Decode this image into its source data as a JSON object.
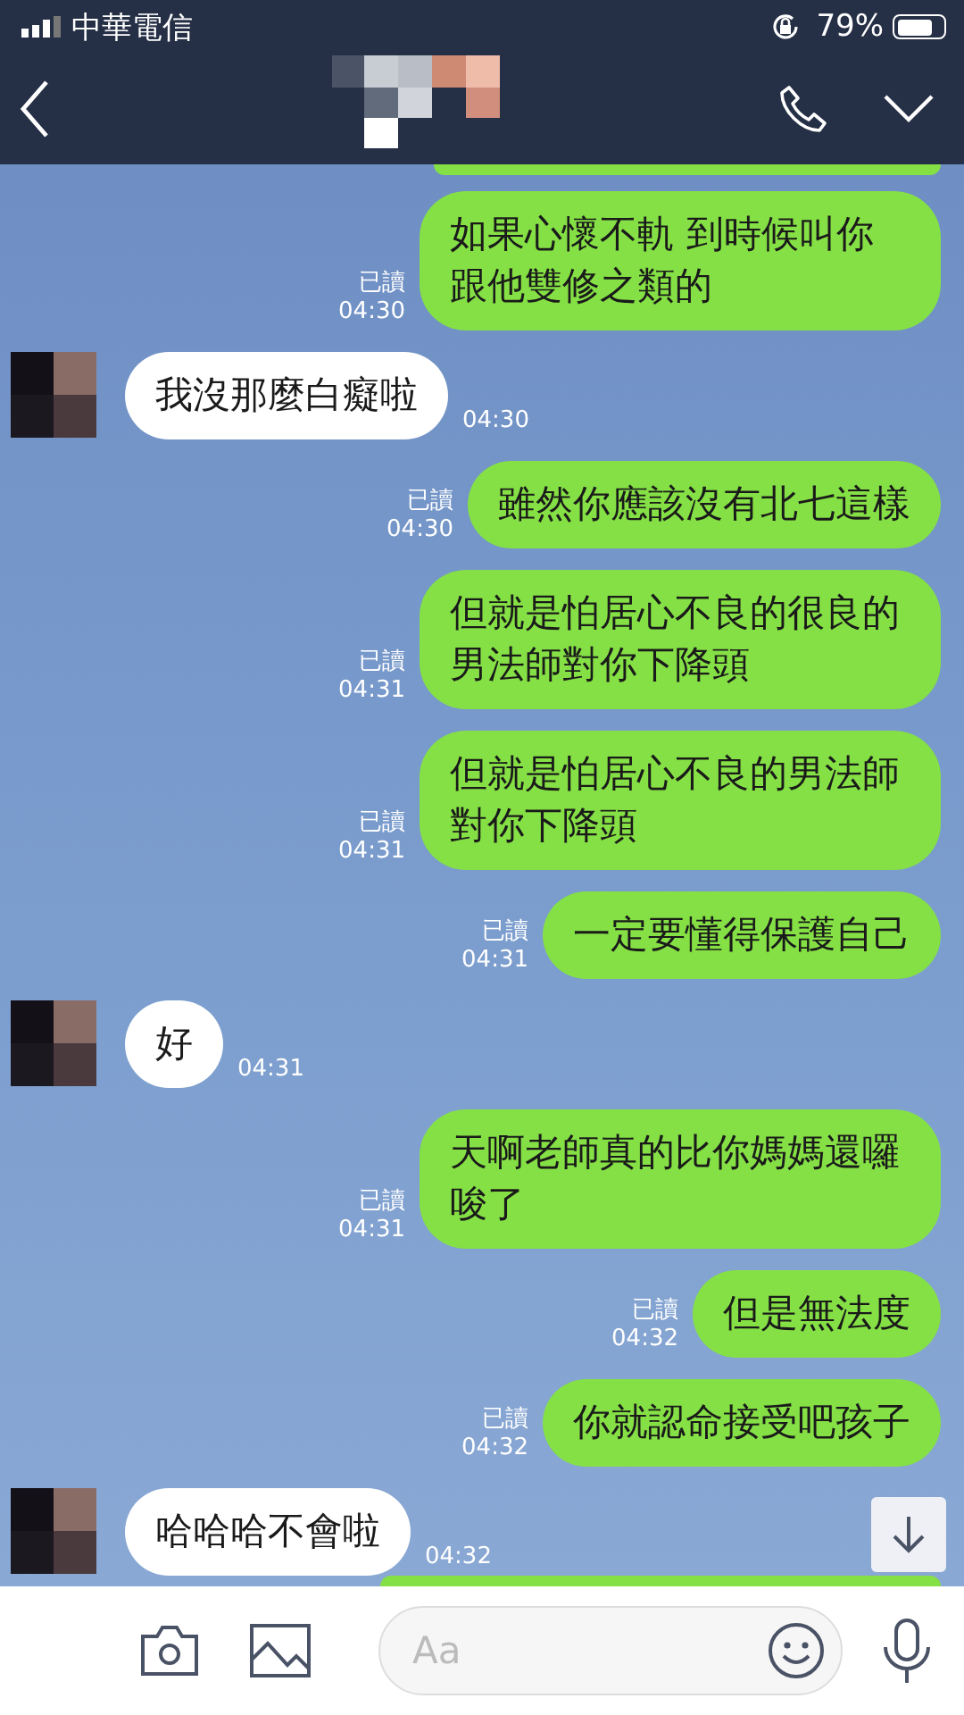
{
  "status_bar": {
    "carrier": "中華電信",
    "battery": "79%"
  },
  "messages": [
    {
      "kind": "sent",
      "text": "如果心懷不軌 到時候叫你跟他雙修之類的",
      "read": "已讀",
      "time": "04:30"
    },
    {
      "kind": "received",
      "text": "我沒那麼白癡啦",
      "time": "04:30"
    },
    {
      "kind": "sent",
      "text": "雖然你應該沒有北七這樣",
      "read": "已讀",
      "time": "04:30"
    },
    {
      "kind": "sent",
      "text": "但就是怕居心不良的很良的男法師對你下降頭",
      "read": "已讀",
      "time": "04:31"
    },
    {
      "kind": "sent",
      "text": "但就是怕居心不良的男法師對你下降頭",
      "read": "已讀",
      "time": "04:31"
    },
    {
      "kind": "sent",
      "text": "一定要懂得保護自己",
      "read": "已讀",
      "time": "04:31"
    },
    {
      "kind": "received",
      "text": "好",
      "time": "04:31"
    },
    {
      "kind": "sent",
      "text": "天啊老師真的比你媽媽還囉唆了",
      "read": "已讀",
      "time": "04:31"
    },
    {
      "kind": "sent",
      "text": "但是無法度",
      "read": "已讀",
      "time": "04:32"
    },
    {
      "kind": "sent",
      "text": "你就認命接受吧孩子",
      "read": "已讀",
      "time": "04:32"
    },
    {
      "kind": "received",
      "text": "哈哈哈不會啦",
      "time": "04:32"
    }
  ],
  "input": {
    "placeholder": "Aa"
  }
}
